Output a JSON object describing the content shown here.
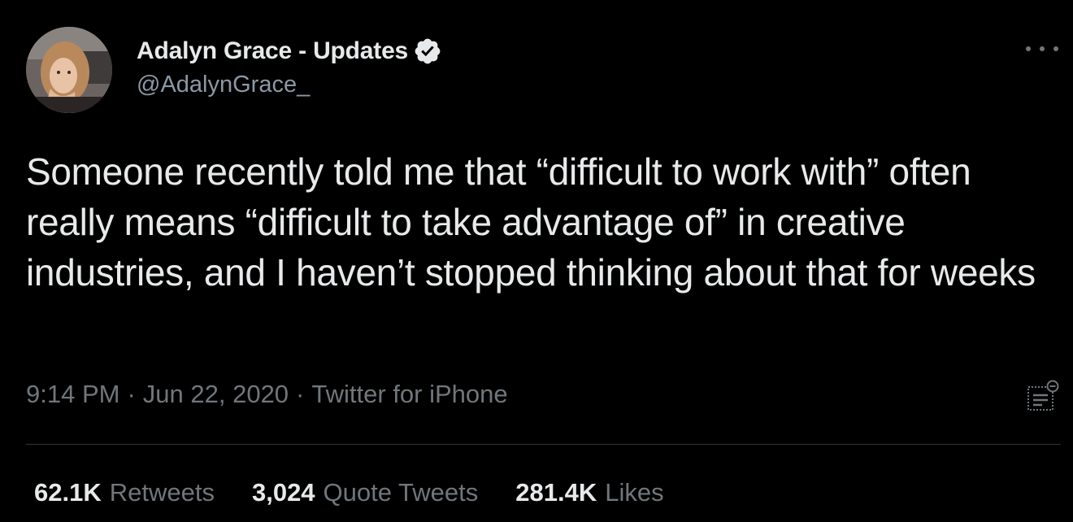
{
  "author": {
    "display_name": "Adalyn Grace - Updates",
    "handle": "@AdalynGrace_",
    "verified": true,
    "avatar_icon": "profile-photo",
    "verified_icon": "verified-badge-icon"
  },
  "tweet": {
    "text": "Someone recently told me that “difficult to work with” often really means “difficult to take advantage of” in creative industries, and I haven’t stopped thinking about that for weeks",
    "time": "9:14 PM",
    "separator": "·",
    "date": "Jun 22, 2020",
    "source": "Twitter for iPhone"
  },
  "stats": {
    "retweets_count": "62.1K",
    "retweets_label": "Retweets",
    "quote_tweets_count": "3,024",
    "quote_tweets_label": "Quote Tweets",
    "likes_count": "281.4K",
    "likes_label": "Likes"
  },
  "colors": {
    "background": "#000000",
    "primary_text": "#e7e9ea",
    "secondary_text": "#71767b",
    "divider": "#2f3336"
  }
}
